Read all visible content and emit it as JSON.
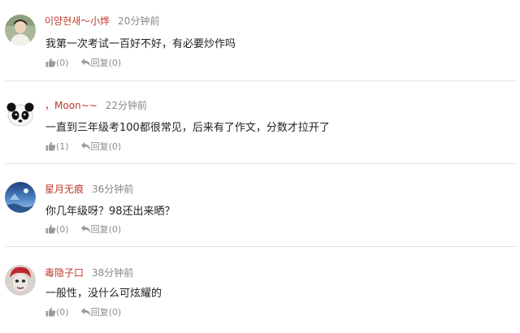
{
  "comments": [
    {
      "username": "이양현새～小烨",
      "time": "20分钟前",
      "text": "我第一次考试一百好不好，有必要炒作吗",
      "likes": "(0)",
      "reply_label": "回复",
      "replies": "(0)",
      "avatar_icon": "person-photo-avatar"
    },
    {
      "username": "，Moon~~",
      "time": "22分钟前",
      "text": "一直到三年级考100都很常见，后来有了作文，分数才拉开了",
      "likes": "(1)",
      "reply_label": "回复",
      "replies": "(0)",
      "avatar_icon": "panda-avatar"
    },
    {
      "username": "星月无痕",
      "time": "36分钟前",
      "text": "你几年级呀？98还出来晒？",
      "likes": "(0)",
      "reply_label": "回复",
      "replies": "(0)",
      "avatar_icon": "blue-scenery-avatar"
    },
    {
      "username": "毒隐子口",
      "time": "38分钟前",
      "text": "一般性，没什么可炫耀的",
      "likes": "(0)",
      "reply_label": "回复",
      "replies": "(0)",
      "avatar_icon": "red-hair-face-avatar"
    }
  ],
  "colors": {
    "username": "#c0392b",
    "meta": "#888888",
    "text": "#222222",
    "divider": "#e4e4e4"
  }
}
